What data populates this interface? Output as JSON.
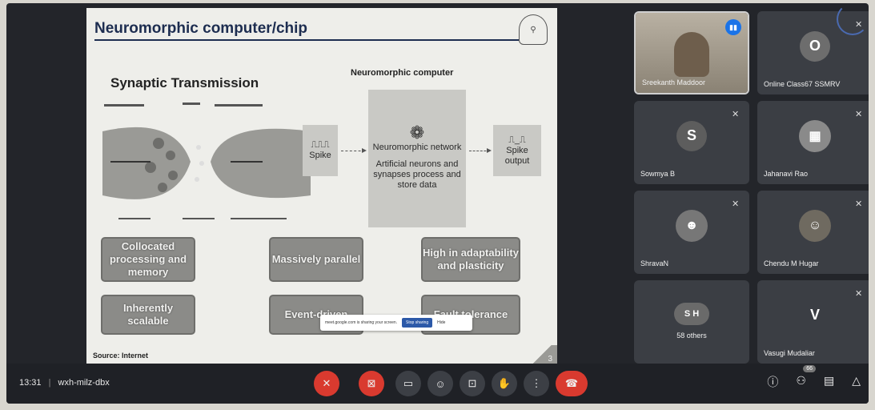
{
  "slide": {
    "title": "Neuromorphic computer/chip",
    "synaptic_title": "Synaptic Transmission",
    "neuro_title": "Neuromorphic computer",
    "spike_label": "Spike",
    "network_label": "Neuromorphic network",
    "network_desc": "Artificial neurons and synapses process and store data",
    "output_label": "Spike output",
    "features": [
      "Collocated processing and memory",
      "Massively parallel",
      "High in adaptability and plasticity",
      "Inherently scalable",
      "Event-driven",
      "Fault tolerance"
    ],
    "source": "Source: Internet",
    "page_number": "3"
  },
  "share_bar": {
    "message": "meet.google.com is sharing your screen.",
    "stop_label": "Stop sharing",
    "hide_label": "Hide"
  },
  "participants": [
    {
      "name": "Sreekanth Maddoor",
      "initial": "",
      "type": "video",
      "color": "#8a7b6a"
    },
    {
      "name": "Online Class67 SSMRV",
      "initial": "O",
      "type": "avatar",
      "color": "#6d6d6d"
    },
    {
      "name": "Sowmya B",
      "initial": "S",
      "type": "avatar",
      "color": "#5d5d5d"
    },
    {
      "name": "Jahanavi Rao",
      "initial": "",
      "type": "photo",
      "color": "#8a8a8a"
    },
    {
      "name": "ShravaN",
      "initial": "",
      "type": "photo",
      "color": "#777"
    },
    {
      "name": "Chendu M Hugar",
      "initial": "",
      "type": "photo",
      "color": "#6f6a60"
    },
    {
      "name": "58 others",
      "initial": "S H",
      "type": "group",
      "color": "#6a6a6a"
    },
    {
      "name": "Vasugi Mudaliar",
      "initial": "V",
      "type": "avatar",
      "color": "#3b3e44"
    }
  ],
  "bottom_bar": {
    "time": "13:31",
    "separator": "|",
    "meeting_code": "wxh-milz-dbx",
    "participant_count": "66"
  },
  "controls": [
    {
      "name": "mic-off-button",
      "glyph": "✕"
    },
    {
      "name": "camera-off-button",
      "glyph": "⊠"
    },
    {
      "name": "captions-button",
      "glyph": "▭"
    },
    {
      "name": "emoji-button",
      "glyph": "☺"
    },
    {
      "name": "present-button",
      "glyph": "⊡"
    },
    {
      "name": "raise-hand-button",
      "glyph": "✋"
    },
    {
      "name": "more-options-button",
      "glyph": "⋮"
    }
  ]
}
